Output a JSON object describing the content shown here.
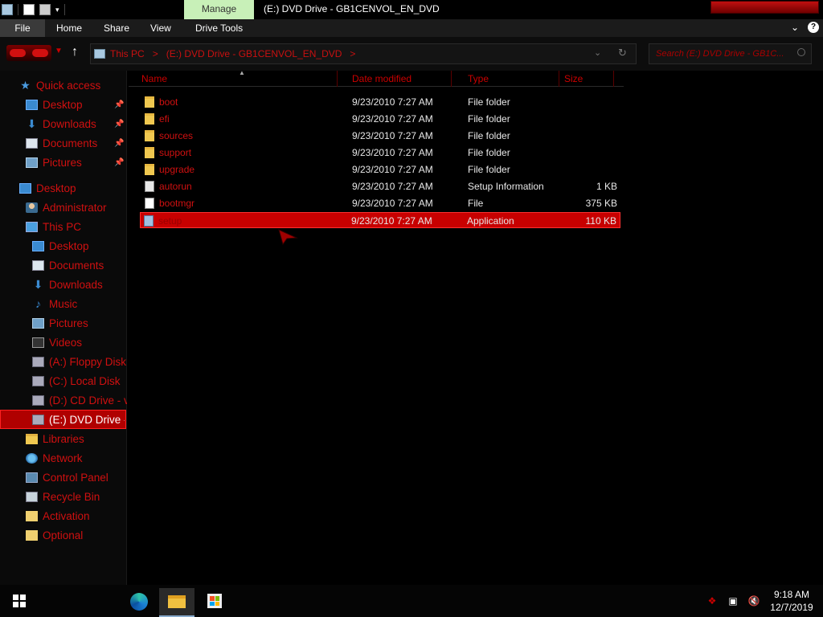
{
  "window": {
    "title": "(E:) DVD Drive - GB1CENVOL_EN_DVD",
    "context_tab": "Manage"
  },
  "ribbon": {
    "tabs": [
      "File",
      "Home",
      "Share",
      "View",
      "Drive Tools"
    ]
  },
  "address": {
    "crumbs": [
      "This PC",
      ">",
      "(E:) DVD Drive - GB1CENVOL_EN_DVD",
      ">"
    ],
    "search_placeholder": "Search (E:) DVD Drive - GB1C..."
  },
  "sidebar": {
    "items": [
      {
        "label": "Quick access",
        "icon": "star-icon"
      },
      {
        "label": "Desktop",
        "icon": "desktop-icon",
        "pinned": true
      },
      {
        "label": "Downloads",
        "icon": "download-icon",
        "pinned": true
      },
      {
        "label": "Documents",
        "icon": "documents-icon",
        "pinned": true
      },
      {
        "label": "Pictures",
        "icon": "pictures-icon",
        "pinned": true
      },
      {
        "label": "Desktop",
        "icon": "desktop-icon"
      },
      {
        "label": "Administrator",
        "icon": "user-icon"
      },
      {
        "label": "This PC",
        "icon": "computer-icon"
      },
      {
        "label": "Desktop",
        "icon": "desktop-icon"
      },
      {
        "label": "Documents",
        "icon": "documents-icon"
      },
      {
        "label": "Downloads",
        "icon": "download-icon"
      },
      {
        "label": "Music",
        "icon": "music-icon"
      },
      {
        "label": "Pictures",
        "icon": "pictures-icon"
      },
      {
        "label": "Videos",
        "icon": "videos-icon"
      },
      {
        "label": "(A:) Floppy Disk",
        "icon": "floppy-drive-icon"
      },
      {
        "label": "(C:) Local Disk",
        "icon": "local-disk-icon"
      },
      {
        "label": "(D:) CD Drive - vi",
        "icon": "cd-drive-icon"
      },
      {
        "label": "(E:) DVD Drive - ",
        "icon": "dvd-drive-icon",
        "selected": true
      },
      {
        "label": "Libraries",
        "icon": "libraries-icon"
      },
      {
        "label": "Network",
        "icon": "network-icon"
      },
      {
        "label": "Control Panel",
        "icon": "control-panel-icon"
      },
      {
        "label": "Recycle Bin",
        "icon": "recycle-bin-icon"
      },
      {
        "label": "Activation",
        "icon": "folder-icon"
      },
      {
        "label": "Optional",
        "icon": "folder-icon"
      }
    ]
  },
  "columns": [
    "Name",
    "Date modified",
    "Type",
    "Size"
  ],
  "files": [
    {
      "name": "boot",
      "date": "9/23/2010 7:27 AM",
      "type": "File folder",
      "size": "",
      "icon": "folder-icon"
    },
    {
      "name": "efi",
      "date": "9/23/2010 7:27 AM",
      "type": "File folder",
      "size": "",
      "icon": "folder-icon"
    },
    {
      "name": "sources",
      "date": "9/23/2010 7:27 AM",
      "type": "File folder",
      "size": "",
      "icon": "folder-icon"
    },
    {
      "name": "support",
      "date": "9/23/2010 7:27 AM",
      "type": "File folder",
      "size": "",
      "icon": "folder-icon"
    },
    {
      "name": "upgrade",
      "date": "9/23/2010 7:27 AM",
      "type": "File folder",
      "size": "",
      "icon": "folder-icon"
    },
    {
      "name": "autorun",
      "date": "9/23/2010 7:27 AM",
      "type": "Setup Information",
      "size": "1 KB",
      "icon": "setup-info-icon"
    },
    {
      "name": "bootmgr",
      "date": "9/23/2010 7:27 AM",
      "type": "File",
      "size": "375 KB",
      "icon": "file-icon"
    },
    {
      "name": "setup",
      "date": "9/23/2010 7:27 AM",
      "type": "Application",
      "size": "110 KB",
      "icon": "application-icon",
      "selected": true
    }
  ],
  "taskbar": {
    "time": "9:18 AM",
    "date": "12/7/2019"
  },
  "colors": {
    "accent": "#d01010",
    "selection": "#c80000",
    "manage_tab": "#c8f0b8"
  }
}
